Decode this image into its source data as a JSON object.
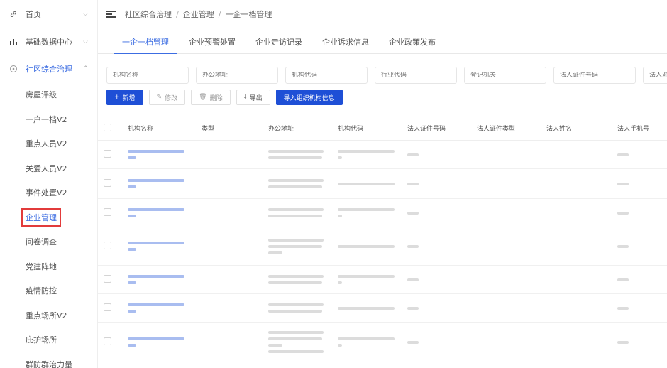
{
  "sidebar": {
    "home": {
      "label": "首页",
      "icon": "link-icon"
    },
    "data_center": {
      "label": "基础数据中心",
      "icon": "bar-chart-icon"
    },
    "community": {
      "label": "社区综合治理",
      "icon": "circle-icon"
    },
    "sub_items": [
      {
        "label": "房屋评级",
        "name": "house-rating"
      },
      {
        "label": "一户一档V2",
        "name": "household-file"
      },
      {
        "label": "重点人员V2",
        "name": "key-person"
      },
      {
        "label": "关爱人员V2",
        "name": "care-person"
      },
      {
        "label": "事件处置V2",
        "name": "event-handling"
      },
      {
        "label": "企业管理",
        "name": "enterprise-mgmt",
        "active": true
      },
      {
        "label": "问卷调查",
        "name": "survey"
      },
      {
        "label": "党建阵地",
        "name": "party-building"
      },
      {
        "label": "疫情防控",
        "name": "epidemic-control"
      },
      {
        "label": "重点场所V2",
        "name": "key-places"
      },
      {
        "label": "庇护场所",
        "name": "shelter"
      },
      {
        "label": "群防群治力量",
        "name": "mass-defense"
      }
    ]
  },
  "breadcrumb": [
    "社区综合治理",
    "企业管理",
    "一企一档管理"
  ],
  "tabs": [
    "一企一档管理",
    "企业预警处置",
    "企业走访记录",
    "企业诉求信息",
    "企业政策发布"
  ],
  "filters": [
    "机构名称",
    "办公地址",
    "机构代码",
    "行业代码",
    "登记机关",
    "法人证件号码",
    "法人对"
  ],
  "actions": {
    "add": "新增",
    "edit": "修改",
    "delete": "删除",
    "export": "导出",
    "import": "导入组织机构信息"
  },
  "table": {
    "headers": [
      "机构名称",
      "类型",
      "办公地址",
      "机构代码",
      "法人证件号码",
      "法人证件类型",
      "法人姓名",
      "法人手机号"
    ]
  },
  "colors": {
    "accent": "#3c6de2",
    "primary_button": "#1e4fd6",
    "active_outline": "#e23b3b"
  }
}
